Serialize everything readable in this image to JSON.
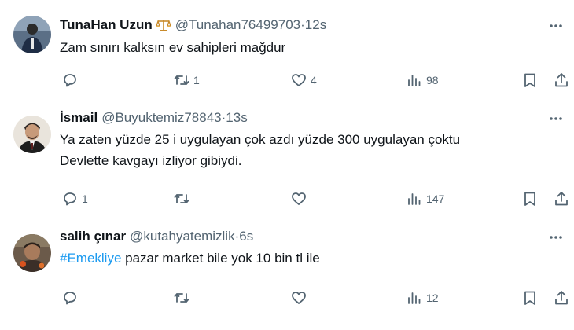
{
  "tweets": [
    {
      "name": "TunaHan Uzun",
      "handle": "@Tunahan76499703",
      "time": "12s",
      "text": "Zam sınırı kalksın ev sahipleri mağdur",
      "replies": "",
      "retweets": "1",
      "likes": "4",
      "views": "98"
    },
    {
      "name": "İsmail",
      "handle": "@Buyuktemiz78843",
      "time": "13s",
      "text_line1": "Ya zaten yüzde 25 i uygulayan çok azdı yüzde 300 uygulayan çoktu",
      "text_line2": "Devlette kavgayı izliyor gibiydi.",
      "replies": "1",
      "retweets": "",
      "likes": "",
      "views": "147"
    },
    {
      "name": "salih çınar",
      "handle": "@kutahyatemizlik",
      "time": "6s",
      "hashtag": "#Emekliye",
      "text": " pazar market bile yok 10 bin tl ile",
      "replies": "",
      "retweets": "",
      "likes": "",
      "views": "12"
    }
  ],
  "separator": " · ",
  "colors": {
    "text": "#0f1419",
    "secondary": "#536471",
    "link": "#1d9bf0",
    "divider": "#eff3f4"
  },
  "icons": [
    "scales-badge-icon",
    "more-icon",
    "reply-icon",
    "retweet-icon",
    "like-icon",
    "views-icon",
    "bookmark-icon",
    "share-icon"
  ]
}
